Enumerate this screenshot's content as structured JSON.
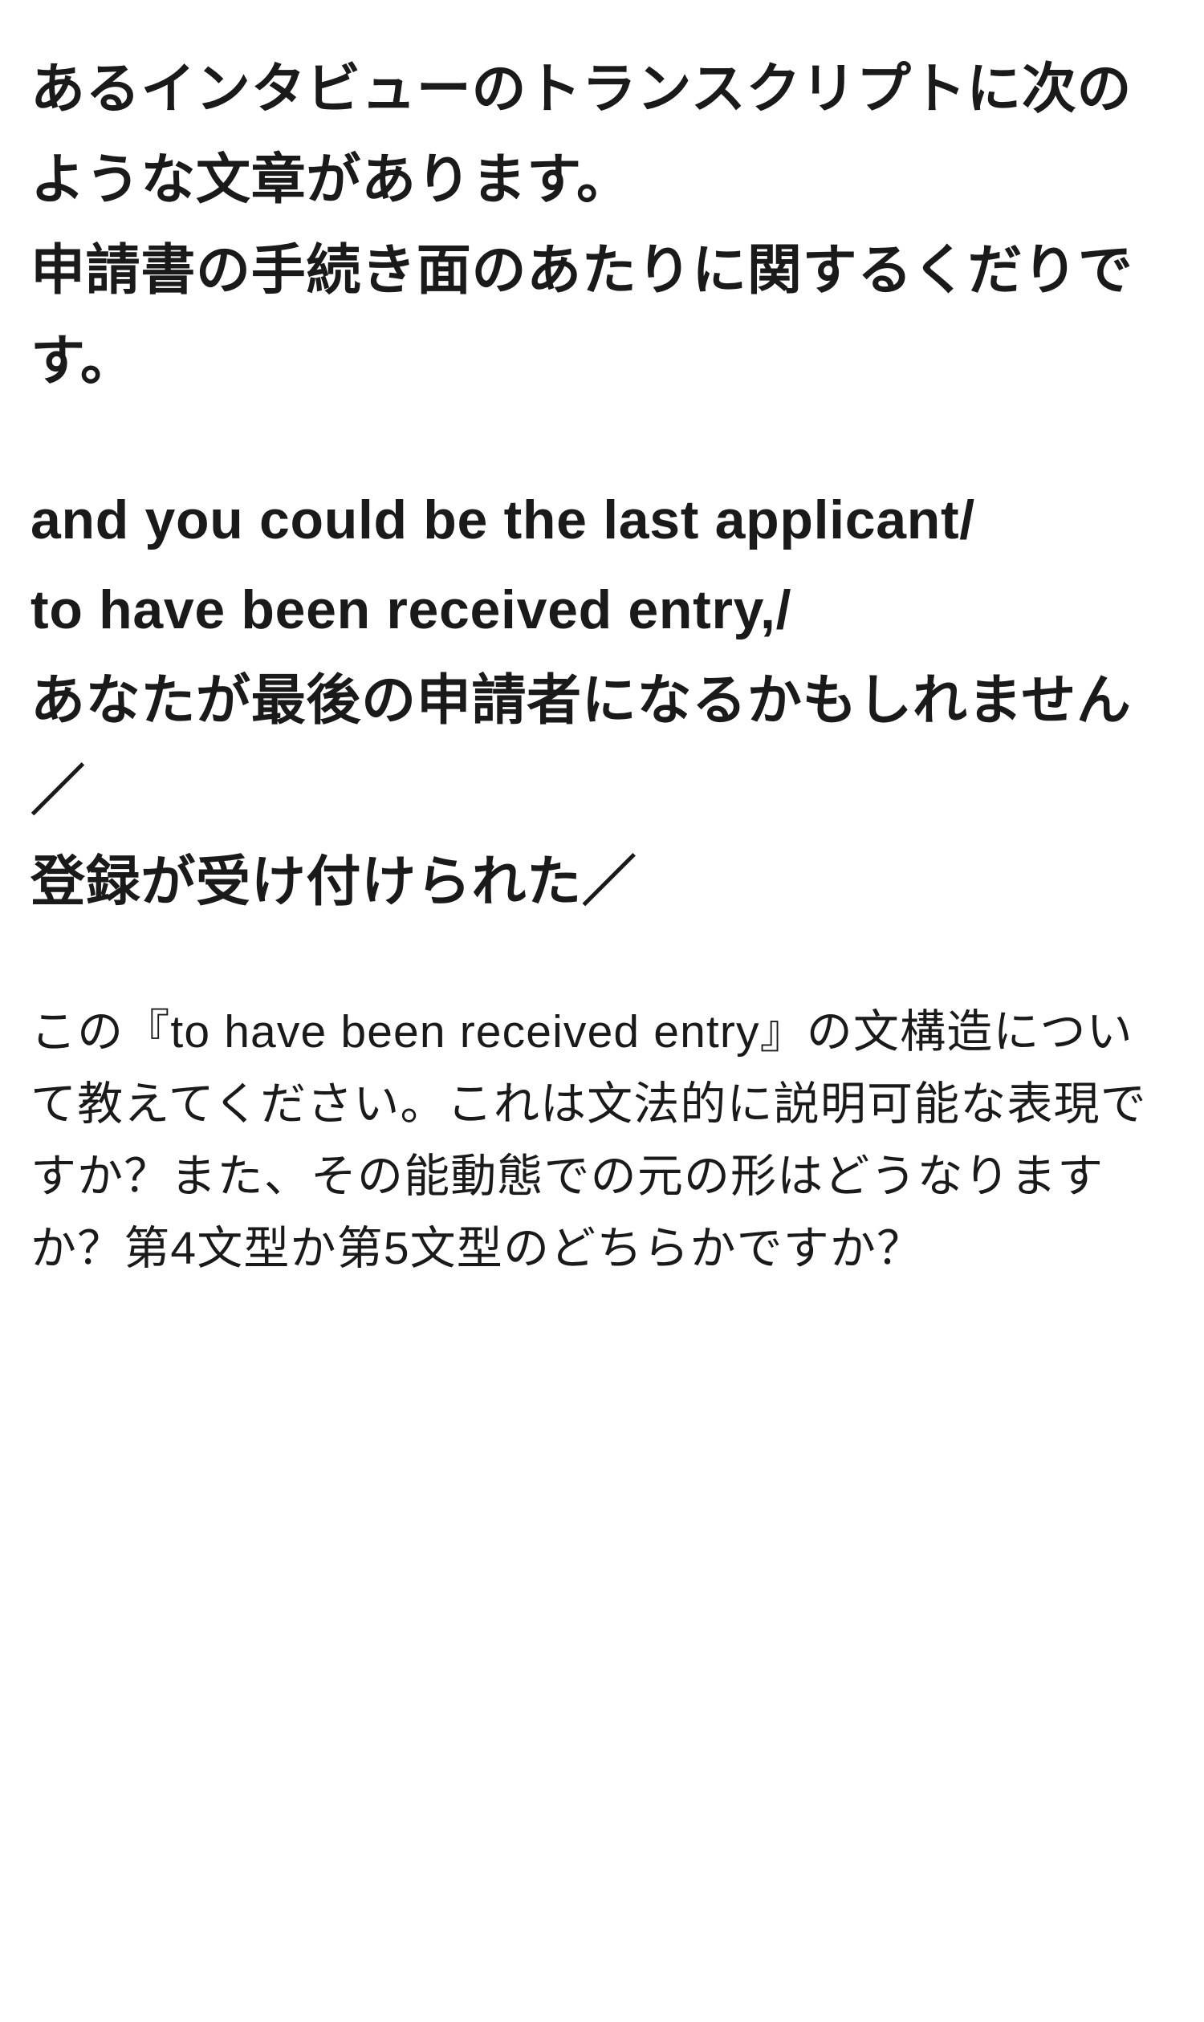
{
  "intro": {
    "line1": "あるインタビューのトランスクリプトに次のような文章があります。",
    "line2": "申請書の手続き面のあたりに関するくだりです。"
  },
  "transcript": {
    "en1": "and you could be the last applicant/",
    "en2": "to have been received entry,/",
    "ja1": "あなたが最後の申請者になるかもしれません／",
    "ja2": "登録が受け付けられた／"
  },
  "question": "この『to have been received entry』の文構造について教えてください。これは文法的に説明可能な表現ですか？また、その能動態での元の形はどうなりますか？第4文型か第5文型のどちらかですか？"
}
